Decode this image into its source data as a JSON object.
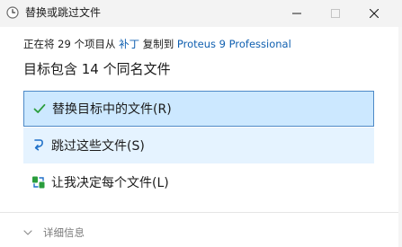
{
  "window": {
    "title": "替换或跳过文件",
    "controls": {
      "minimize": "minimize",
      "maximize": "maximize",
      "close": "close"
    }
  },
  "copy_info": {
    "prefix": "正在将 29 个项目从 ",
    "source": "补丁",
    "middle": " 复制到 ",
    "destination": "Proteus 9 Professional"
  },
  "heading": "目标包含 14 个同名文件",
  "options": [
    {
      "label": "替换目标中的文件(R)",
      "icon": "checkmark-icon",
      "state": "focused"
    },
    {
      "label": "跳过这些文件(S)",
      "icon": "skip-arrow-icon",
      "state": "hover"
    },
    {
      "label": "让我决定每个文件(L)",
      "icon": "compare-files-icon",
      "state": "normal"
    }
  ],
  "details": {
    "label": "详细信息"
  },
  "colors": {
    "accent": "#0f5fb0",
    "focus_bg": "#cce8ff",
    "focus_border": "#4d89c7",
    "hover_bg": "#e5f3ff",
    "check_green": "#2a9d3c"
  }
}
